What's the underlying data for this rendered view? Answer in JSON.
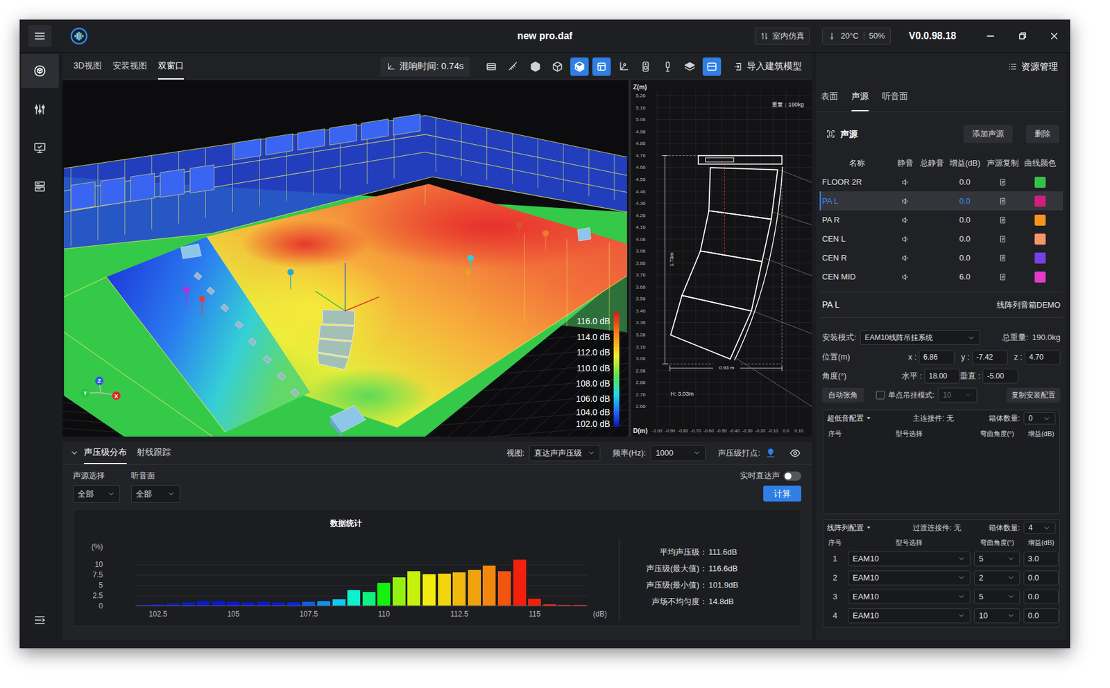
{
  "window": {
    "title": "new pro.daf",
    "mode": "室内仿真",
    "temperature": "20°C",
    "humidity": "50%",
    "version": "V0.0.98.18"
  },
  "sidebar": {
    "items": [
      {
        "kind": "view3d",
        "selected": true
      },
      {
        "kind": "tuning",
        "selected": false
      },
      {
        "kind": "display",
        "selected": false
      },
      {
        "kind": "list",
        "selected": false
      }
    ]
  },
  "view_toolbar": {
    "tabs": [
      {
        "label": "3D视图",
        "selected": false
      },
      {
        "label": "安装视图",
        "selected": false
      },
      {
        "label": "双窗口",
        "selected": true
      }
    ],
    "reverb": "混响时间: 0.74s",
    "tools": [
      {
        "kind": "plane",
        "selected": false
      },
      {
        "kind": "ruler",
        "selected": false
      },
      {
        "kind": "solid",
        "selected": false
      },
      {
        "kind": "wire",
        "selected": false
      },
      {
        "kind": "shaded",
        "selected": true
      },
      {
        "kind": "camera",
        "selected": true
      },
      {
        "kind": "axes",
        "selected": false
      },
      {
        "kind": "speaker",
        "selected": false
      },
      {
        "kind": "mic",
        "selected": false
      },
      {
        "kind": "layers",
        "selected": false
      },
      {
        "kind": "surface",
        "selected": true
      }
    ],
    "import": "导入建筑模型"
  },
  "scene": {
    "legend": [
      "116.0 dB",
      "114.0 dB",
      "112.0 dB",
      "110.0 dB",
      "108.0 dB",
      "106.0 dB",
      "104.0 dB",
      "102.0 dB"
    ],
    "axes": [
      {
        "label": "Y",
        "color": "#22c33a"
      },
      {
        "label": "Z",
        "color": "#2f5fe0"
      },
      {
        "label": "X",
        "color": "#e02828"
      }
    ]
  },
  "elevation": {
    "z_label": "Z(m)",
    "z_ticks": [
      "5.26",
      "5.16",
      "5.06",
      "4.96",
      "4.86",
      "4.76",
      "4.66",
      "4.56",
      "4.46",
      "4.36",
      "4.26",
      "4.16",
      "4.06",
      "3.96",
      "3.86",
      "3.76",
      "3.66",
      "3.56",
      "3.46",
      "3.36",
      "3.26",
      "3.16",
      "3.06",
      "2.96",
      "2.86",
      "2.76",
      "2.66"
    ],
    "d_label": "D(m)",
    "d_ticks": [
      "-1.00",
      "-0.90",
      "-0.80",
      "-0.70",
      "-0.60",
      "-0.50",
      "-0.40",
      "-0.30",
      "-0.20",
      "-0.10",
      "0.0",
      "0.10"
    ],
    "weight": "重量：190kg",
    "height": "1.73m",
    "width": "0.93 m",
    "h": "H: 3.03m"
  },
  "analysis": {
    "tabs": [
      {
        "label": "声压级分布",
        "selected": true
      },
      {
        "label": "射线跟踪",
        "selected": false
      }
    ],
    "view_label": "视图:",
    "view_value": "直达声声压级",
    "freq_label": "频率(Hz):",
    "freq_value": "1000",
    "mark_label": "声压级打点:",
    "source_label": "声源选择",
    "source_value": "全部",
    "surface_label": "听音面",
    "surface_value": "全部",
    "realtime_label": "实时直达声",
    "realtime_on": false,
    "compute": "计算",
    "chart": {
      "title": "数据统计",
      "y_unit": "(%)",
      "y_ticks": [
        "10",
        "7.5",
        "5",
        "2.5",
        "0"
      ],
      "x_ticks": [
        "102.5",
        "105",
        "107.5",
        "110",
        "112.5",
        "115"
      ],
      "x_unit": "(dB)",
      "values": [
        0.1,
        0.3,
        0.5,
        0.8,
        1.0,
        1.1,
        0.9,
        0.7,
        0.9,
        0.7,
        0.8,
        0.9,
        1.1,
        1.5,
        3.7,
        3.2,
        5.4,
        6.8,
        8.2,
        7.5,
        7.7,
        8.0,
        8.6,
        9.5,
        8.3,
        11.0,
        1.6,
        0.3,
        0.2,
        0.1
      ]
    },
    "stats": [
      {
        "label": "平均声压级：",
        "value": "111.6dB"
      },
      {
        "label": "声压级(最大值)：",
        "value": "116.6dB"
      },
      {
        "label": "声压级(最小值)：",
        "value": "101.9dB"
      },
      {
        "label": "声场不均匀度：",
        "value": "14.8dB"
      }
    ]
  },
  "resources": {
    "title": "资源管理",
    "tabs": [
      {
        "label": "表面",
        "selected": false
      },
      {
        "label": "声源",
        "selected": true
      },
      {
        "label": "听音面",
        "selected": false
      }
    ],
    "section": "声源",
    "add": "添加声源",
    "delete": "删除",
    "columns": [
      "名称",
      "静音",
      "总静音",
      "增益(dB)",
      "声源复制",
      "曲线颜色"
    ],
    "sources": [
      {
        "name": "FLOOR 2R",
        "muted": false,
        "gain": "0.0",
        "color": "#34c24c",
        "selected": false
      },
      {
        "name": "PA L",
        "muted": false,
        "gain": "0.0",
        "color": "#d11f7a",
        "selected": true
      },
      {
        "name": "PA R",
        "muted": false,
        "gain": "0.0",
        "color": "#f7931e",
        "selected": false
      },
      {
        "name": "CEN L",
        "muted": false,
        "gain": "0.0",
        "color": "#f59868",
        "selected": false
      },
      {
        "name": "CEN R",
        "muted": false,
        "gain": "0.0",
        "color": "#7a3fe0",
        "selected": false
      },
      {
        "name": "CEN MID",
        "muted": false,
        "gain": "6.0",
        "color": "#e03cc8",
        "selected": false
      }
    ],
    "detail": {
      "name": "PA L",
      "model": "线阵列音箱DEMO",
      "mount_label": "安装模式:",
      "mount_value": "EAM10线阵吊挂系统",
      "weight_label": "总重量:",
      "weight_value": "190.0kg",
      "position_label": "位置(m)",
      "position": [
        {
          "label": "x :",
          "value": "6.86"
        },
        {
          "label": "y :",
          "value": "-7.42"
        },
        {
          "label": "z :",
          "value": "4.70"
        }
      ],
      "angle_label": "角度(°)",
      "angles": [
        {
          "label": "水平 :",
          "value": "18.00"
        },
        {
          "label": "垂直 :",
          "value": "-5.00"
        }
      ],
      "auto_splay": "自动张角",
      "single_point": {
        "label": "单点吊挂模式:",
        "checked": false,
        "value": "10",
        "disabled": true
      },
      "copy_config": "复制安装配置"
    },
    "subwoofer": {
      "title": "超低音配置",
      "connector": "主连接件: 无",
      "count_label": "箱体数量:",
      "count": "0",
      "columns": [
        "序号",
        "型号选择",
        "弯曲角度(°)",
        "增益(dB)"
      ],
      "rows": []
    },
    "line_array": {
      "title": "线阵列配置",
      "connector": "过渡连接件: 无",
      "count_label": "箱体数量:",
      "count": "4",
      "columns": [
        "序号",
        "型号选择",
        "弯曲角度(°)",
        "增益(dB)"
      ],
      "rows": [
        {
          "index": "1",
          "model": "EAM10",
          "angle": "5",
          "gain": "3.0"
        },
        {
          "index": "2",
          "model": "EAM10",
          "angle": "2",
          "gain": "0.0"
        },
        {
          "index": "3",
          "model": "EAM10",
          "angle": "5",
          "gain": "0.0"
        },
        {
          "index": "4",
          "model": "EAM10",
          "angle": "10",
          "gain": "0.0"
        }
      ]
    }
  }
}
